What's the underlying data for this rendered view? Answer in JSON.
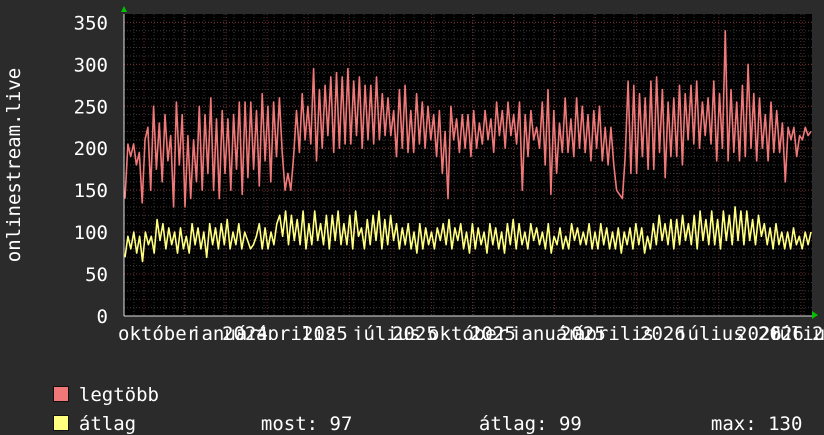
{
  "chart_data": {
    "type": "line",
    "ylabel": "onlinestream.live",
    "ylim": [
      0,
      360
    ],
    "yticks": [
      0,
      50,
      100,
      150,
      200,
      250,
      300,
      350
    ],
    "xtick_labels": [
      "október",
      "január",
      "2024",
      "április",
      "2025",
      "július",
      "2025",
      "október",
      "2025",
      "január",
      "2025",
      "április",
      "2026",
      "július",
      "2026",
      "2026",
      "július",
      "2"
    ],
    "grid": true,
    "series": [
      {
        "name": "legtöbb",
        "color": "#f07878",
        "values": [
          140,
          205,
          190,
          205,
          180,
          195,
          135,
          210,
          225,
          150,
          250,
          175,
          230,
          160,
          240,
          185,
          215,
          130,
          255,
          180,
          240,
          130,
          215,
          140,
          210,
          160,
          250,
          150,
          240,
          170,
          260,
          150,
          235,
          140,
          245,
          170,
          235,
          150,
          240,
          175,
          255,
          145,
          255,
          165,
          255,
          175,
          245,
          155,
          265,
          185,
          250,
          160,
          255,
          190,
          260,
          195,
          150,
          170,
          150,
          190,
          245,
          195,
          265,
          210,
          250,
          205,
          295,
          185,
          270,
          200,
          275,
          215,
          285,
          195,
          290,
          200,
          285,
          205,
          295,
          205,
          280,
          215,
          285,
          200,
          275,
          210,
          275,
          205,
          285,
          210,
          265,
          215,
          260,
          215,
          245,
          190,
          270,
          200,
          275,
          195,
          245,
          195,
          265,
          205,
          255,
          200,
          250,
          210,
          240,
          190,
          245,
          170,
          220,
          140,
          250,
          210,
          235,
          195,
          240,
          200,
          240,
          190,
          245,
          200,
          230,
          205,
          245,
          210,
          235,
          195,
          255,
          215,
          245,
          200,
          255,
          215,
          240,
          205,
          255,
          150,
          240,
          190,
          245,
          210,
          225,
          200,
          255,
          180,
          270,
          145,
          245,
          170,
          230,
          195,
          260,
          195,
          235,
          190,
          260,
          200,
          250,
          195,
          240,
          185,
          245,
          200,
          250,
          185,
          225,
          180,
          225,
          180,
          150,
          145,
          140,
          190,
          280,
          170,
          275,
          170,
          265,
          190,
          260,
          175,
          280,
          175,
          285,
          195,
          270,
          165,
          255,
          190,
          260,
          190,
          275,
          180,
          265,
          210,
          275,
          205,
          280,
          200,
          255,
          215,
          260,
          205,
          280,
          185,
          265,
          200,
          340,
          185,
          270,
          195,
          255,
          185,
          275,
          190,
          300,
          200,
          265,
          185,
          260,
          200,
          240,
          185,
          255,
          195,
          245,
          195,
          230,
          160,
          225,
          210,
          225,
          190,
          215,
          210,
          225,
          215,
          220
        ]
      },
      {
        "name": "átlag",
        "color": "#ffff80",
        "values": [
          70,
          95,
          80,
          100,
          75,
          95,
          65,
          100,
          85,
          95,
          75,
          115,
          90,
          110,
          80,
          105,
          85,
          100,
          75,
          105,
          80,
          95,
          75,
          110,
          85,
          105,
          80,
          100,
          70,
          110,
          85,
          105,
          80,
          110,
          85,
          115,
          80,
          100,
          85,
          110,
          80,
          100,
          90,
          80,
          85,
          95,
          110,
          80,
          105,
          80,
          100,
          85,
          110,
          120,
          95,
          125,
          85,
          120,
          90,
          115,
          85,
          125,
          80,
          110,
          85,
          125,
          90,
          110,
          85,
          120,
          80,
          120,
          90,
          125,
          85,
          110,
          85,
          120,
          80,
          125,
          95,
          105,
          80,
          115,
          85,
          120,
          90,
          125,
          80,
          115,
          85,
          120,
          90,
          110,
          80,
          105,
          85,
          110,
          80,
          100,
          75,
          110,
          80,
          105,
          85,
          100,
          80,
          105,
          90,
          110,
          85,
          115,
          80,
          105,
          90,
          110,
          80,
          100,
          75,
          110,
          80,
          105,
          85,
          100,
          75,
          110,
          85,
          105,
          80,
          100,
          75,
          110,
          85,
          115,
          80,
          110,
          85,
          100,
          80,
          110,
          90,
          105,
          85,
          100,
          80,
          110,
          75,
          95,
          85,
          105,
          80,
          95,
          80,
          110,
          90,
          105,
          85,
          100,
          85,
          110,
          80,
          100,
          80,
          110,
          85,
          105,
          80,
          100,
          80,
          105,
          75,
          100,
          85,
          105,
          80,
          110,
          85,
          105,
          75,
          95,
          80,
          110,
          85,
          120,
          90,
          110,
          85,
          115,
          80,
          115,
          85,
          120,
          90,
          110,
          85,
          120,
          80,
          125,
          90,
          115,
          85,
          125,
          85,
          115,
          80,
          125,
          90,
          120,
          85,
          130,
          90,
          125,
          85,
          125,
          90,
          115,
          85,
          120,
          95,
          110,
          85,
          105,
          80,
          110,
          85,
          100,
          80,
          100,
          80,
          105,
          85,
          95,
          80,
          100,
          85,
          100
        ]
      }
    ],
    "legend": [
      {
        "label": "legtöbb",
        "color": "#f07878"
      },
      {
        "label": "átlag",
        "color": "#ffff80"
      }
    ],
    "stats": {
      "current_label": "most:",
      "current_value": "97",
      "avg_label": "átlag:",
      "avg_value": "99",
      "max_label": "max:",
      "max_value": "130"
    }
  }
}
